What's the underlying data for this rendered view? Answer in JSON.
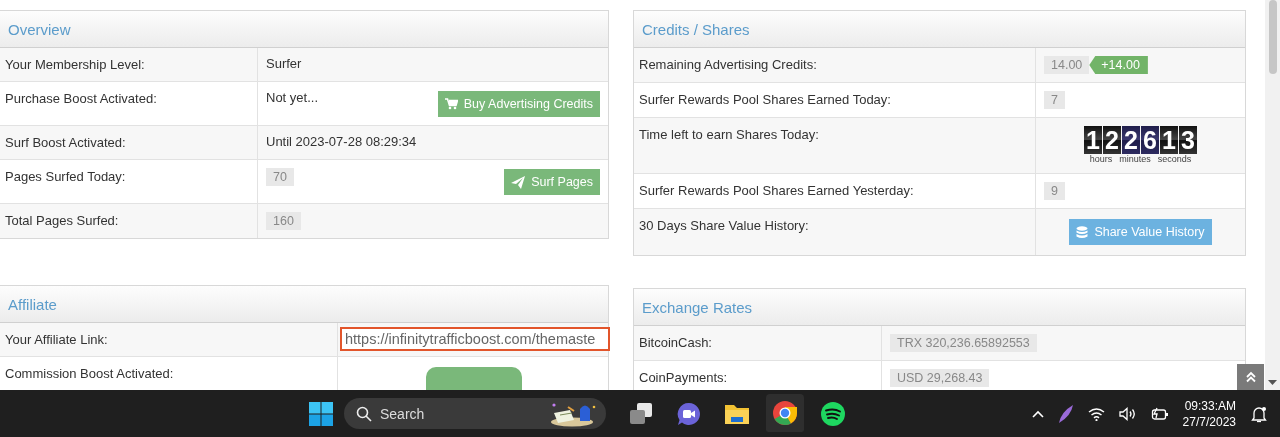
{
  "panels_left": [
    {
      "title": "Overview",
      "rows": [
        {
          "label": "Your Membership Level:",
          "kind": "text",
          "value": "Surfer"
        },
        {
          "label": "Purchase Boost Activated:",
          "kind": "text_button",
          "value": "Not yet...",
          "button": {
            "label": "Buy Advertising Credits"
          }
        },
        {
          "label": "Surf Boost Activated:",
          "kind": "text",
          "value": "Until 2023-07-28 08:29:34"
        },
        {
          "label": "Pages Surfed Today:",
          "kind": "badge_button",
          "value": "70",
          "button": {
            "label": "Surf Pages"
          }
        },
        {
          "label": "Total Pages Surfed:",
          "kind": "badge",
          "value": "160"
        }
      ]
    },
    {
      "title": "Affiliate",
      "rows": [
        {
          "label": "Your Affiliate Link:",
          "kind": "link_field",
          "value": "https://infinitytrafficboost.com/themaste"
        },
        {
          "label": "Commission Boost Activated:",
          "kind": "cut_button"
        }
      ]
    }
  ],
  "panels_right": [
    {
      "title": "Credits / Shares",
      "rows": [
        {
          "label": "Remaining Advertising Credits:",
          "kind": "badge_delta",
          "value": "14.00",
          "delta": "+14.00"
        },
        {
          "label": "Surfer Rewards Pool Shares Earned Today:",
          "kind": "badge",
          "value": "7"
        },
        {
          "label": "Time left to earn Shares Today:",
          "kind": "countdown",
          "digits": [
            "1",
            "2",
            "2",
            "6",
            "1",
            "3"
          ],
          "units": [
            "hours",
            "minutes",
            "seconds"
          ]
        },
        {
          "label": "Surfer Rewards Pool Shares Earned Yesterday:",
          "kind": "badge",
          "value": "9"
        },
        {
          "label": "30 Days Share Value History:",
          "kind": "button",
          "button": {
            "label": "Share Value History"
          }
        }
      ]
    },
    {
      "title": "Exchange Rates",
      "rows": [
        {
          "label": "BitcoinCash:",
          "kind": "badge",
          "value": "TRX 320,236.65892553"
        },
        {
          "label": "CoinPayments:",
          "kind": "badge",
          "value": "USD 29,268.43"
        }
      ]
    }
  ],
  "taskbar": {
    "search": {
      "placeholder": "Search"
    },
    "time": "09:33:AM",
    "date": "27/7/2023"
  }
}
